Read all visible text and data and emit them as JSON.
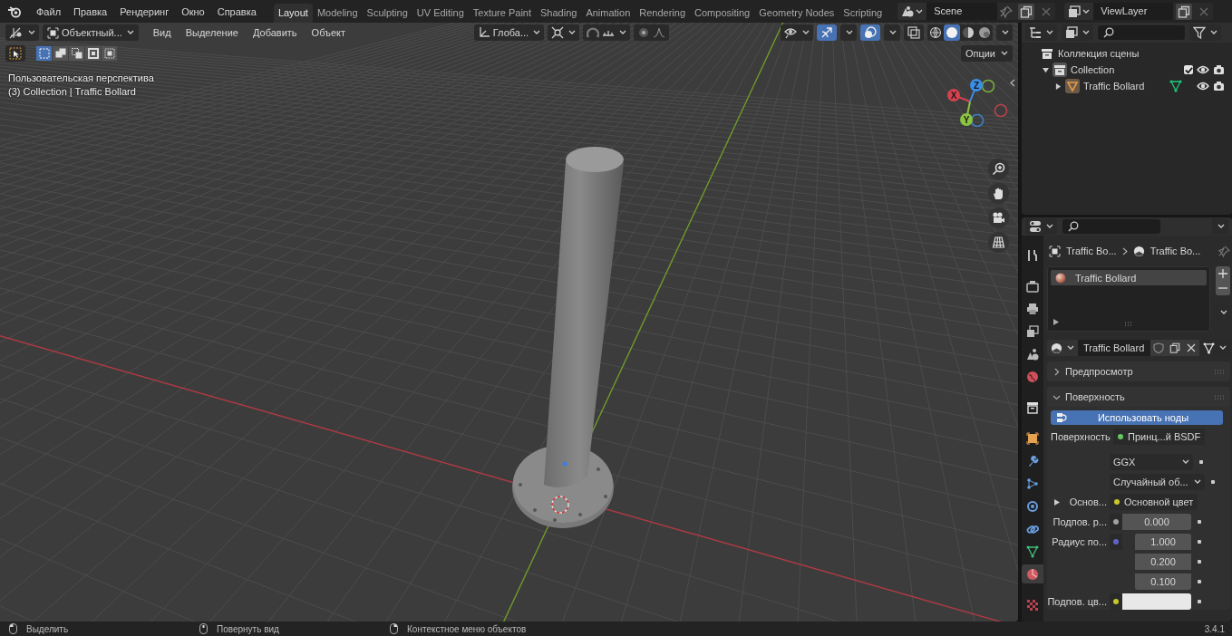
{
  "top_bar": {
    "menus": [
      "Файл",
      "Правка",
      "Рендеринг",
      "Окно",
      "Справка"
    ],
    "workspaces": [
      {
        "label": "Layout",
        "selected": true
      },
      {
        "label": "Modeling",
        "selected": false
      },
      {
        "label": "Sculpting",
        "selected": false
      },
      {
        "label": "UV Editing",
        "selected": false
      },
      {
        "label": "Texture Paint",
        "selected": false
      },
      {
        "label": "Shading",
        "selected": false
      },
      {
        "label": "Animation",
        "selected": false
      },
      {
        "label": "Rendering",
        "selected": false
      },
      {
        "label": "Compositing",
        "selected": false
      },
      {
        "label": "Geometry Nodes",
        "selected": false
      },
      {
        "label": "Scripting",
        "selected": false
      }
    ],
    "scene": "Scene",
    "view_layer": "ViewLayer"
  },
  "viewport": {
    "mode": "Объектный...",
    "menus": [
      "Вид",
      "Выделение",
      "Добавить",
      "Объект"
    ],
    "transform_orientation": "Глоба...",
    "gizmos_shown": true,
    "overlays_shown": true,
    "shading_modes": [
      {
        "kind": "wireframe",
        "selected": false
      },
      {
        "kind": "solid",
        "selected": true
      },
      {
        "kind": "material",
        "selected": false
      },
      {
        "kind": "rendered",
        "selected": false
      }
    ],
    "select_modes": [
      {
        "selected": true
      },
      {
        "selected": false
      },
      {
        "selected": false
      },
      {
        "selected": false
      },
      {
        "selected": false
      }
    ],
    "options": "Опции",
    "view_name": "Пользовательская перспектива",
    "object_info": "(3) Collection | Traffic Bollard",
    "gizmo_axes": [
      {
        "label": "X",
        "color": "#d5424f"
      },
      {
        "label": "Y",
        "color": "#8bc43f"
      },
      {
        "label": "Z",
        "color": "#3b8ee6"
      }
    ]
  },
  "outliner": {
    "tree": [
      {
        "label": "Коллекция сцены",
        "kind": "scene_collection",
        "children": [
          {
            "label": "Collection",
            "kind": "collection",
            "expanded": true,
            "checked": true,
            "children": [
              {
                "label": "Traffic Bollard",
                "kind": "object",
                "expanded": false
              }
            ]
          }
        ]
      }
    ]
  },
  "properties": {
    "tabs": [
      {
        "kind": "tool",
        "selected": false
      },
      {
        "kind": "render",
        "selected": false
      },
      {
        "kind": "output",
        "selected": false
      },
      {
        "kind": "view_layer",
        "selected": false
      },
      {
        "kind": "scene",
        "selected": false
      },
      {
        "kind": "world",
        "selected": false
      },
      {
        "kind": "collection",
        "selected": false
      },
      {
        "kind": "object",
        "selected": false
      },
      {
        "kind": "modifiers",
        "selected": false
      },
      {
        "kind": "particles",
        "selected": false
      },
      {
        "kind": "physics",
        "selected": false
      },
      {
        "kind": "constraints",
        "selected": false
      },
      {
        "kind": "data",
        "selected": false
      },
      {
        "kind": "material",
        "selected": true
      },
      {
        "kind": "texture",
        "selected": false
      }
    ],
    "breadcrumb": [
      "Traffic Bo...",
      "Traffic Bo..."
    ],
    "material_slots": [
      {
        "label": "Traffic Bollard",
        "selected": true
      }
    ],
    "material_name": "Traffic Bollard",
    "panels": [
      {
        "title": "Предпросмотр",
        "expanded": false
      },
      {
        "title": "Поверхность",
        "expanded": true
      }
    ],
    "use_nodes_button": "Использовать ноды",
    "fields": [
      {
        "kind": "link",
        "label": "Поверхность",
        "value": "Принц...й BSDF",
        "color": "#63c763"
      },
      {
        "kind": "dropdown",
        "value": "GGX"
      },
      {
        "kind": "dropdown",
        "value": "Случайный об..."
      },
      {
        "kind": "link_expand",
        "label": "Основ...",
        "value": "Основной цвет",
        "color": "#c7c729"
      },
      {
        "kind": "number",
        "label": "Подпов. р...",
        "value": "0.000",
        "color": "#a1a1a1"
      },
      {
        "kind": "vector",
        "label": "Радиус по...",
        "values": [
          "1.000",
          "0.200",
          "0.100"
        ],
        "color": "#6363c7"
      },
      {
        "kind": "color",
        "label": "Подпов. цв...",
        "color": "#c7c729"
      }
    ]
  },
  "status_bar": {
    "hints": [
      {
        "kind": "left_mouse",
        "label": "Выделить"
      },
      {
        "kind": "middle_mouse",
        "label": "Повернуть вид"
      },
      {
        "kind": "right_mouse",
        "label": "Контекстное меню объектов"
      }
    ],
    "version": "3.4.1"
  }
}
